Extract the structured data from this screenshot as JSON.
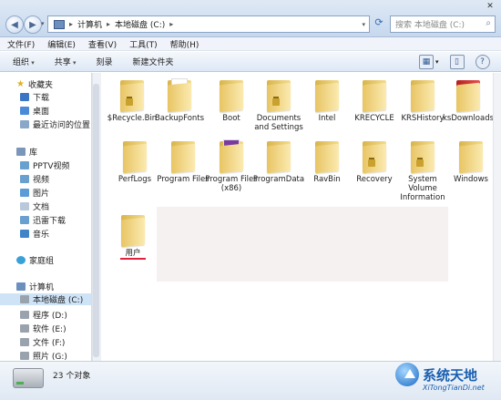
{
  "address": {
    "crumbs": [
      "计算机",
      "本地磁盘 (C:)"
    ],
    "search_placeholder": "搜索 本地磁盘 (C:)"
  },
  "menu": [
    "文件(F)",
    "编辑(E)",
    "查看(V)",
    "工具(T)",
    "帮助(H)"
  ],
  "toolbar": [
    "组织",
    "共享",
    "刻录",
    "新建文件夹"
  ],
  "nav": {
    "favorites": "收藏夹",
    "fav_items": [
      "下载",
      "桌面",
      "最近访问的位置"
    ],
    "libraries": "库",
    "lib_items": [
      "PPTV视频",
      "视频",
      "图片",
      "文档",
      "迅雷下载",
      "音乐"
    ],
    "homegroup": "家庭组",
    "computer": "计算机",
    "drives": [
      "本地磁盘 (C:)",
      "程序 (D:)",
      "软件 (E:)",
      "文件 (F:)",
      "照片 (G:)"
    ]
  },
  "files": [
    "$Recycle.Bin",
    "BackupFonts",
    "Boot",
    "Documents and Settings",
    "Intel",
    "KRECYCLE",
    "KRSHistory",
    "ksDownloads",
    "PerfLogs",
    "Program Files",
    "Program Files (x86)",
    "ProgramData",
    "RavBin",
    "Recovery",
    "System Volume Information",
    "Windows",
    "用户"
  ],
  "status": {
    "count": "23 个对象"
  },
  "watermark": {
    "name": "系统天地",
    "url": "XiTongTianDi.net"
  }
}
